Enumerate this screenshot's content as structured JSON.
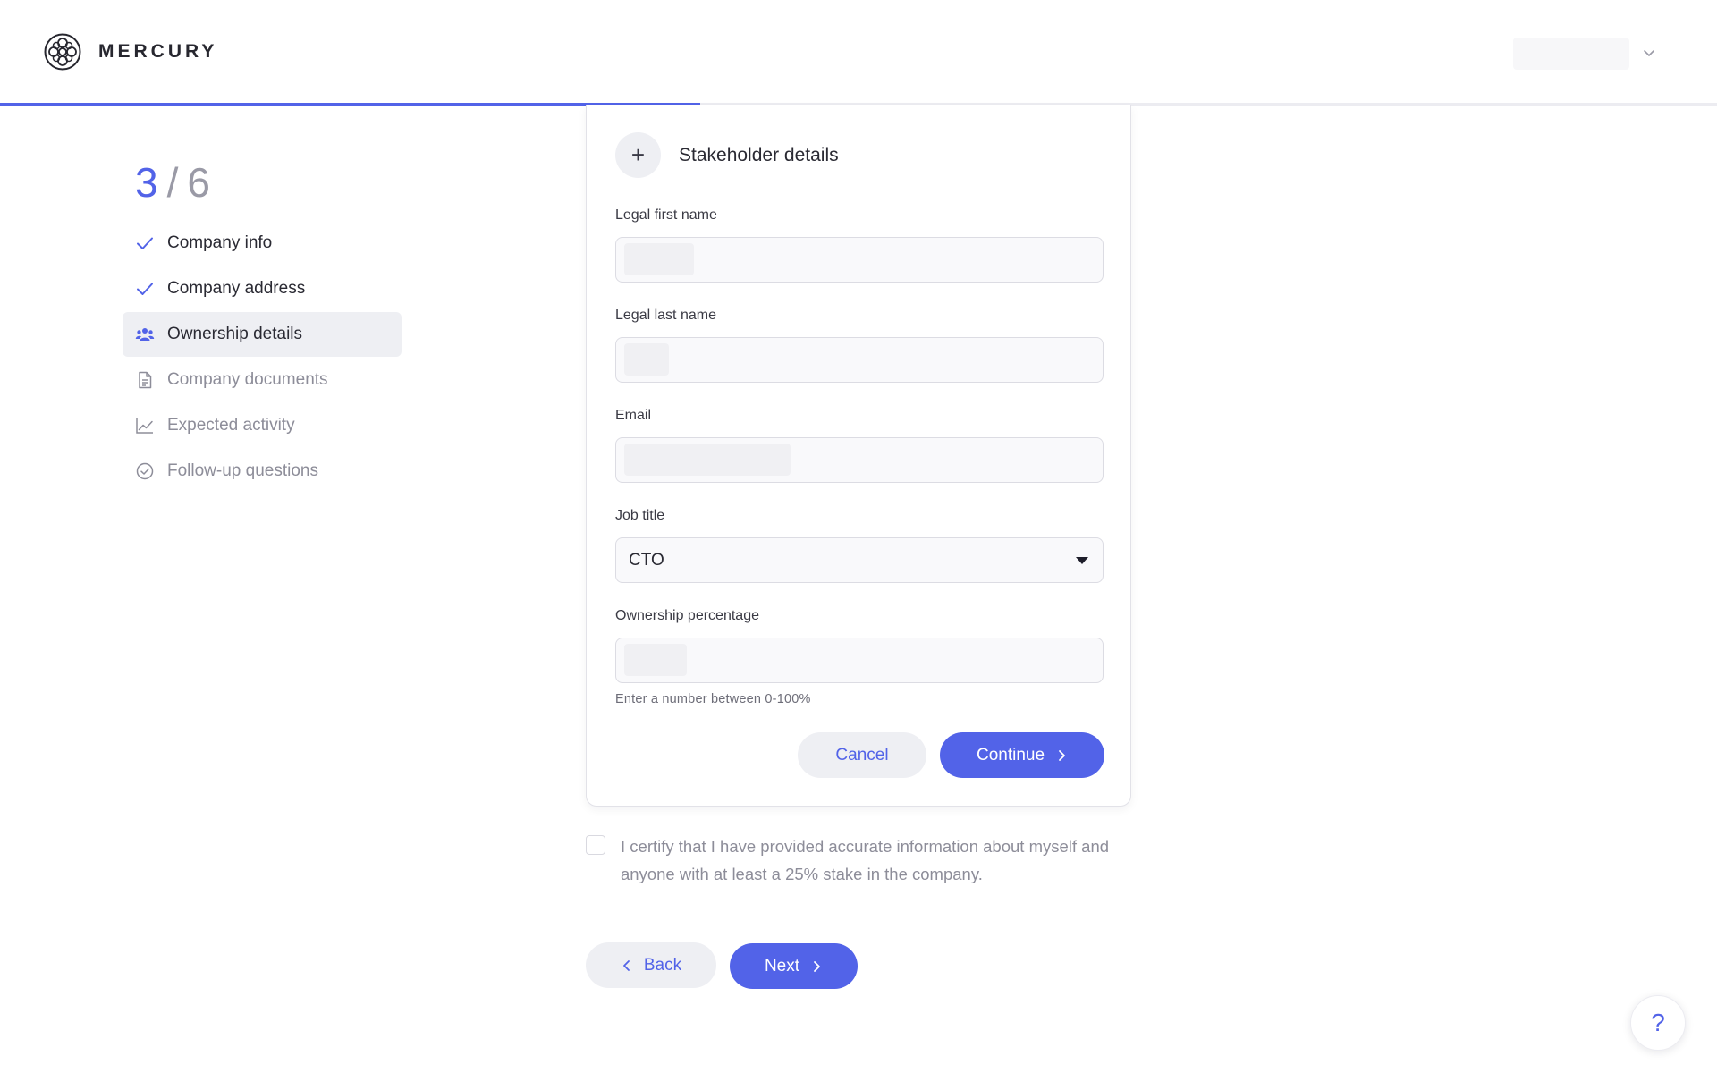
{
  "brand": {
    "name": "MERCURY",
    "accent": "#5263e8"
  },
  "header": {
    "user_menu_icon": "chevron-down-icon",
    "progress_fraction": 0.408
  },
  "steps": {
    "current": "3",
    "separator": "/",
    "total": "6",
    "items": [
      {
        "label": "Company info",
        "icon": "check-icon",
        "state": "done"
      },
      {
        "label": "Company address",
        "icon": "check-icon",
        "state": "done"
      },
      {
        "label": "Ownership details",
        "icon": "people-icon",
        "state": "active"
      },
      {
        "label": "Company documents",
        "icon": "document-icon",
        "state": "pending"
      },
      {
        "label": "Expected activity",
        "icon": "line-chart-icon",
        "state": "pending"
      },
      {
        "label": "Follow-up questions",
        "icon": "check-circle-icon",
        "state": "pending"
      }
    ]
  },
  "form": {
    "title": "Stakeholder details",
    "add_icon": "+",
    "fields": {
      "first_name": {
        "label": "Legal first name",
        "value": ""
      },
      "last_name": {
        "label": "Legal last name",
        "value": ""
      },
      "email": {
        "label": "Email",
        "value": ""
      },
      "job_title": {
        "label": "Job title",
        "value": "CTO"
      },
      "ownership": {
        "label": "Ownership percentage",
        "value": "",
        "hint": "Enter a number between 0-100%"
      }
    },
    "cancel_label": "Cancel",
    "continue_label": "Continue"
  },
  "certify": {
    "text": "I certify that I have provided accurate information about myself and anyone with at least a 25% stake in the company.",
    "checked": false
  },
  "nav": {
    "back_label": "Back",
    "next_label": "Next"
  },
  "help": {
    "label": "?"
  }
}
